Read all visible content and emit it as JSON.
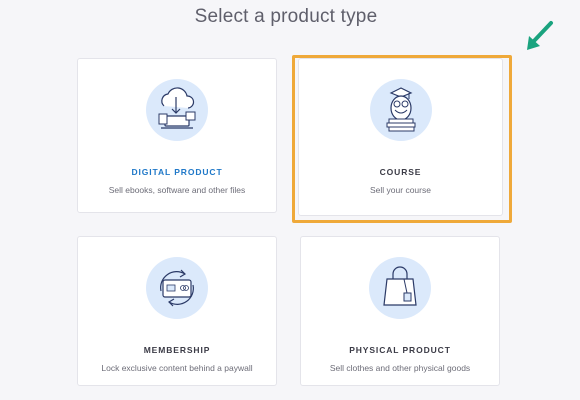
{
  "page": {
    "title": "Select a product type"
  },
  "cards": [
    {
      "label": "DIGITAL PRODUCT",
      "description": "Sell ebooks, software and other files",
      "icon": "cloud-download-icon",
      "accent": true
    },
    {
      "label": "COURSE",
      "description": "Sell your course",
      "icon": "owl-books-icon",
      "selected": true
    },
    {
      "label": "MEMBERSHIP",
      "description": "Lock exclusive content behind a paywall",
      "icon": "credit-card-cycle-icon"
    },
    {
      "label": "PHYSICAL PRODUCT",
      "description": "Sell clothes and other physical goods",
      "icon": "shopping-bag-icon"
    }
  ],
  "annotation": {
    "icon": "pointer-arrow-icon",
    "color": "#1aa37f"
  },
  "colors": {
    "highlight": "#efa93a",
    "accent": "#1f78c8",
    "icon_circle": "#dbe9fb",
    "icon_stroke": "#2b3a67"
  }
}
